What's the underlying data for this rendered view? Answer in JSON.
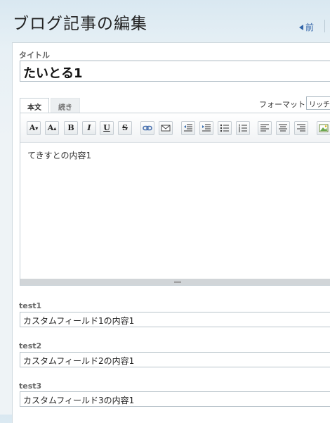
{
  "header": {
    "title": "ブログ記事の編集",
    "prev_label": "前"
  },
  "form": {
    "title_label": "タイトル",
    "title_value": "たいとる1",
    "tabs": [
      {
        "label": "本文",
        "active": true
      },
      {
        "label": "続き",
        "active": false
      }
    ],
    "format_label": "フォーマット:",
    "format_value": "リッチテ",
    "toolbar_icons": [
      "font-size-decrease-icon",
      "font-size-increase-icon",
      "bold-icon",
      "italic-icon",
      "underline-icon",
      "strikethrough-icon",
      "link-icon",
      "email-icon",
      "outdent-icon",
      "indent-icon",
      "bullet-list-icon",
      "numbered-list-icon",
      "align-left-icon",
      "align-center-icon",
      "align-right-icon",
      "insert-image-icon"
    ],
    "toolbar_text": {
      "bold": "B",
      "italic": "I",
      "underline": "U",
      "strike": "S"
    },
    "body_content": "てきすとの内容1"
  },
  "custom_fields": [
    {
      "label": "test1",
      "value": "カスタムフィールド1の内容1"
    },
    {
      "label": "test2",
      "value": "カスタムフィールド2の内容1"
    },
    {
      "label": "test3",
      "value": "カスタムフィールド3の内容1"
    }
  ],
  "colors": {
    "link": "#3366aa",
    "accent": "#5577aa"
  }
}
